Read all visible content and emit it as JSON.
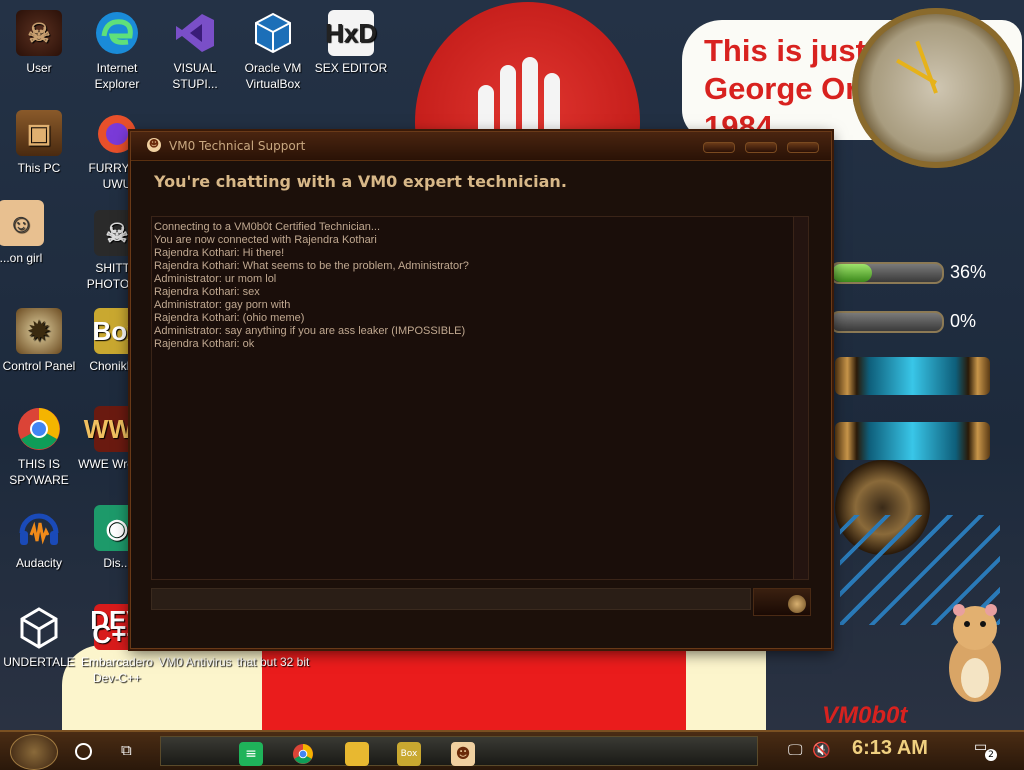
{
  "desktop": {
    "wallpaper_text": "This is just like\nGeorge Orwell's\n1984",
    "wallpaper_brand": "VM0b0t",
    "gauges": [
      {
        "label": "36%",
        "fill": 0.36
      },
      {
        "label": "0%",
        "fill": 0.0
      }
    ],
    "icons": [
      {
        "label": "User",
        "icon": "user-icon"
      },
      {
        "label": "Internet Explorer",
        "icon": "edge-icon"
      },
      {
        "label": "VISUAL STUPI...",
        "icon": "visual-studio-icon"
      },
      {
        "label": "Oracle VM VirtualBox",
        "icon": "virtualbox-icon"
      },
      {
        "label": "SEX EDITOR",
        "icon": "hxd-icon"
      },
      {
        "label": "This PC",
        "icon": "pc-icon"
      },
      {
        "label": "FURRYF... UWU",
        "icon": "firefox-icon"
      },
      {
        "label": "...on girl",
        "icon": "hank-icon"
      },
      {
        "label": "SHITT... PHOTOS...",
        "icon": "skull-icon"
      },
      {
        "label": "Control Panel",
        "icon": "lightbulb-icon"
      },
      {
        "label": "ChonikB...",
        "icon": "box-icon"
      },
      {
        "label": "THIS IS SPYWARE",
        "icon": "chrome-icon"
      },
      {
        "label": "WWE Wrestl...",
        "icon": "wwe-icon"
      },
      {
        "label": "Audacity",
        "icon": "audacity-icon"
      },
      {
        "label": "Dis...",
        "icon": "discord-icon"
      },
      {
        "label": "UNDERTALE",
        "icon": "unity-icon"
      },
      {
        "label": "Embarcadero Dev-C++",
        "icon": "devcpp-icon"
      },
      {
        "label": "VM0 Antivirus",
        "icon": "vm0-icon"
      },
      {
        "label": "that but 32 bit",
        "icon": "file-icon"
      }
    ]
  },
  "window": {
    "title": "VM0 Technical Support",
    "heading": "You're chatting with a VM0 expert technician.",
    "chat_lines": [
      "Connecting to a VM0b0t Certified Technician...",
      "You are now connected with Rajendra Kothari",
      "Rajendra Kothari: Hi there!",
      "Rajendra Kothari: What seems to be the problem, Administrator?",
      "Administrator: ur mom lol",
      "Rajendra Kothari: sex",
      "Administrator: gay porn with",
      "Rajendra Kothari: (ohio meme)",
      "Administrator: say anything if you are ass leaker (IMPOSSIBLE)",
      "Rajendra Kothari: ok"
    ],
    "message_value": "",
    "colors": {
      "bg": "#1c100a",
      "text": "#c0a890",
      "heading": "#d8b888"
    }
  },
  "taskbar": {
    "time": "6:13 AM",
    "notification_count": "2",
    "apps": [
      {
        "icon": "sheets-icon",
        "color": "#1fb35a"
      },
      {
        "icon": "chrome-icon",
        "color": "#e8e8e8"
      },
      {
        "icon": "folder-icon",
        "color": "#e8b830"
      },
      {
        "icon": "box-icon",
        "color": "#c9a830"
      },
      {
        "icon": "technician-icon",
        "color": "#f0d0a0"
      }
    ]
  }
}
